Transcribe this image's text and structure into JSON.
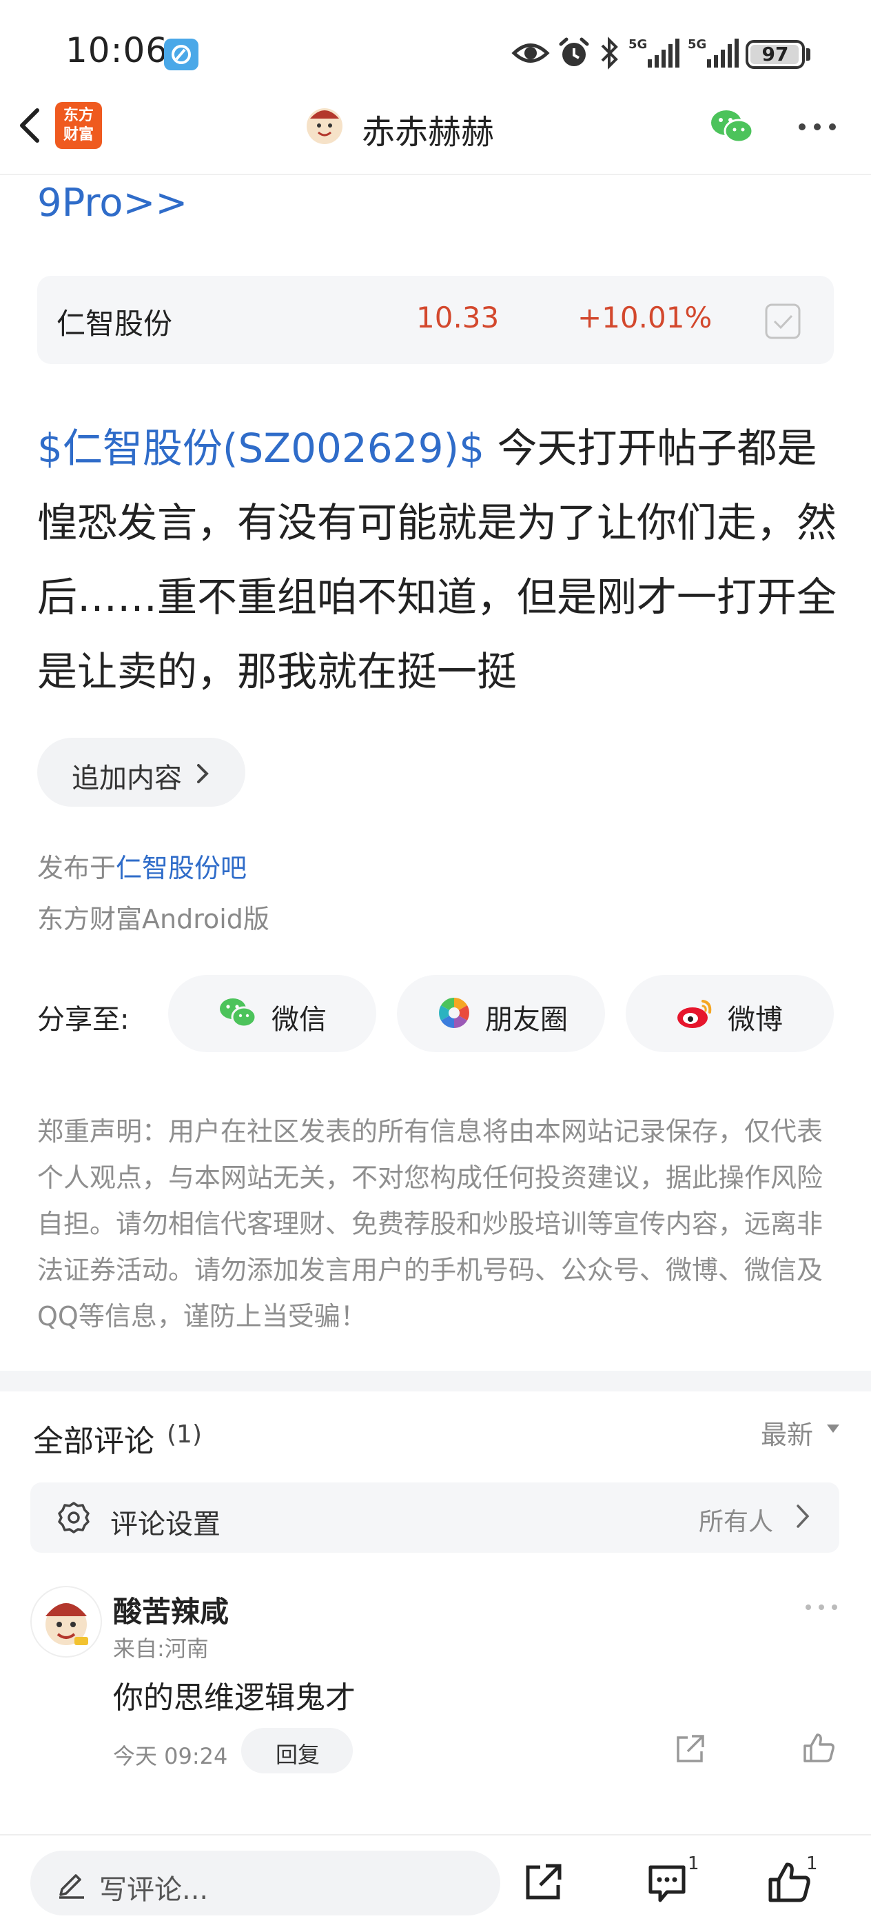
{
  "status_bar": {
    "time": "10:06",
    "battery": "97",
    "battery_level_percent": 97,
    "signal_labels": [
      "5G",
      "5G"
    ]
  },
  "nav": {
    "app_logo_line1": "东方",
    "app_logo_line2": "财富",
    "title": "赤赤赫赫"
  },
  "article": {
    "link_tail": "9Pro>>",
    "stock": {
      "name": "仁智股份",
      "price": "10.33",
      "change": "+10.01%"
    },
    "body_link": "$仁智股份(SZ002629)$",
    "body_text": " 今天打开帖子都是惶恐发言，有没有可能就是为了让你们走，然后……重不重组咱不知道，但是刚才一打开全是让卖的，那我就在挺一挺",
    "append_label": "追加内容",
    "published_prefix": "发布于",
    "published_bar": "仁智股份吧",
    "client": "东方财富Android版"
  },
  "share": {
    "label": "分享至:",
    "items": [
      {
        "label": "微信",
        "icon": "wechat-icon"
      },
      {
        "label": "朋友圈",
        "icon": "moments-icon"
      },
      {
        "label": "微博",
        "icon": "weibo-icon"
      }
    ]
  },
  "disclaimer": "郑重声明：用户在社区发表的所有信息将由本网站记录保存，仅代表个人观点，与本网站无关，不对您构成任何投资建议，据此操作风险自担。请勿相信代客理财、免费荐股和炒股培训等宣传内容，远离非法证券活动。请勿添加发言用户的手机号码、公众号、微博、微信及QQ等信息，谨防上当受骗！",
  "comments": {
    "title": "全部评论",
    "count": "(1)",
    "sort": "最新",
    "settings_label": "评论设置",
    "settings_value": "所有人",
    "items": [
      {
        "name": "酸苦辣咸",
        "location": "来自:河南",
        "text": "你的思维逻辑鬼才",
        "time": "今天 09:24",
        "reply_label": "回复"
      }
    ]
  },
  "bottom_bar": {
    "placeholder": "写评论...",
    "comment_count": "1",
    "like_count": "1"
  },
  "colors": {
    "link_blue": "#2f6cc9",
    "price_red": "#d3482d",
    "brand_orange": "#ef5a1f",
    "wechat_green": "#4cc35b"
  }
}
